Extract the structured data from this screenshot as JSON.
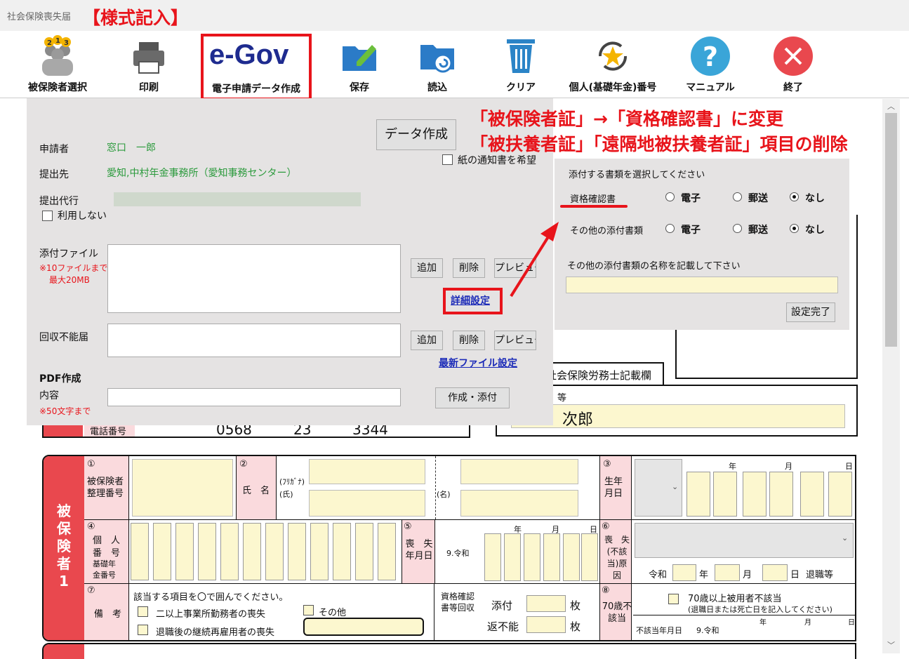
{
  "window": {
    "title": "社会保険喪失届",
    "form_tag": "【様式記入】"
  },
  "toolbar": {
    "items": [
      {
        "label": "被保険者選択"
      },
      {
        "label": "印刷"
      },
      {
        "label": "電子申請データ作成"
      },
      {
        "label": "保存"
      },
      {
        "label": "読込"
      },
      {
        "label": "クリア"
      },
      {
        "label": "個人(基礎年金)番号"
      },
      {
        "label": "マニュアル"
      },
      {
        "label": "終了"
      }
    ],
    "egov_logo": "e-Gov"
  },
  "colors": {
    "accent": "#e8141b",
    "panel": "#e5e3e3",
    "field": "#fcf7cf",
    "pink": "#fadadd",
    "link": "#1b2ab8",
    "green": "#2b9a3c"
  },
  "panel": {
    "create_button": "データ作成",
    "paper_notice": "紙の通知書を希望",
    "applicant_label": "申請者",
    "applicant_value": "窓口　一郎",
    "submit_to_label": "提出先",
    "submit_to_value": "愛知,中村年金事務所（愛知事務センター）",
    "agent_label": "提出代行",
    "no_use_label": "利用しない",
    "attach_label": "添付ファイル",
    "attach_note1": "※10ファイルまで",
    "attach_note2": "最大20MB",
    "add": "追加",
    "delete": "削除",
    "preview": "プレビュー",
    "detail_link": "詳細設定",
    "unrecoverable_label": "回収不能届",
    "latest_link": "最新ファイル設定",
    "pdf_title": "PDF作成",
    "content_label": "内容",
    "content_note": "※50文字まで",
    "create_attach": "作成・添付"
  },
  "detail": {
    "instruction": "添付する書類を選択してください",
    "row1_label": "資格確認書",
    "row2_label": "その他の添付書類",
    "opt_e": "電子",
    "opt_m": "郵送",
    "opt_n": "なし",
    "other_name_label": "その他の添付書類の名称を記載して下さい",
    "done": "設定完了"
  },
  "annotation": {
    "line1": "「被保険者証」→「資格確認書」に変更",
    "line2": "「被扶養者証」「遠隔地被扶養者証」項目の削除"
  },
  "form": {
    "sharoushi": "社会保険労務士記載欄",
    "name_partial": "等",
    "name_value": "次郎",
    "phone_label": "電話番号",
    "phone1": "0568",
    "phone2": "23",
    "phone3": "3344",
    "side_label": "被保険者1",
    "c1": "①",
    "c1_label": "被保険者整理番号",
    "c2": "②",
    "c2_label": "氏　名",
    "furigana": "(ﾌﾘｶﾞﾅ)",
    "shi": "(氏)",
    "mei": "(名)",
    "c3": "③",
    "c3_label": "生年月日",
    "nen": "年",
    "tsuki": "月",
    "hi": "日",
    "c4": "④",
    "c4_l1": "個　人",
    "c4_l2": "番　号",
    "c4_l3": "基礎年",
    "c4_l4": "金番号",
    "c5": "⑤",
    "c5_label": "喪　失年月日",
    "era": "9.令和",
    "c6": "⑥",
    "c6_label": "喪　失(不該当)原　因",
    "reiwa": "令和",
    "taishoku": "退職等",
    "c7": "⑦",
    "c7_label": "備　考",
    "note_head": "該当する項目を〇で囲んでください。",
    "note1": "二以上事業所勤務者の喪失",
    "note2": "その他",
    "note3": "退職後の継続再雇用者の喪失",
    "return_label": "資格確認書等回収",
    "tenpu": "添付",
    "henfuno": "返不能",
    "mai": "枚",
    "c8": "⑧",
    "c8_label": "70歳不該当",
    "over70": "70歳以上被用者不該当",
    "over70_note": "(退職日または死亡日を記入してください)",
    "nongai": "不該当年月日",
    "era2": "9.令和"
  }
}
